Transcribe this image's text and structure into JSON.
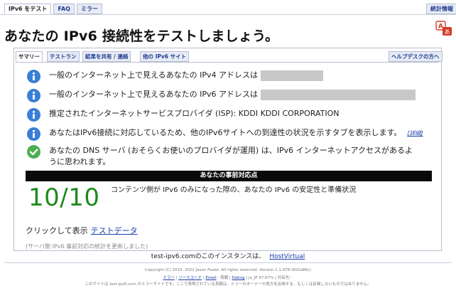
{
  "top_tabs": {
    "test": "IPv6 をテスト",
    "faq": "FAQ",
    "mirrors": "ミラー",
    "stats": "統計情報"
  },
  "headline": "あなたの IPv6 接続性をテストしましょう。",
  "sub_tabs": {
    "summary": "サマリー",
    "test_run": "テストラン",
    "share": "結果を共有 / 連絡",
    "other_sites": "他の IPv6 サイト",
    "helpdesk": "ヘルプデスクの方へ"
  },
  "rows": {
    "ipv4_label": "一般のインターネット上で見えるあなたの IPv4 アドレスは",
    "ipv6_label": "一般のインターネット上で見えるあなたの IPv6 アドレスは",
    "isp": "推定されたインターネットサービスプロバイダ (ISP): KDDI KDDI CORPORATION",
    "tabs_notice": "あなたはIPv6接続に対応しているため、他のIPv6サイトへの到達性の状況を示すタブを表示します。",
    "details_link": "[詳細]",
    "dns": "あなたの DNS サーバ (おそらくお使いのプロバイダが運用) は、IPv6 インターネットアクセスがあるように思われます。"
  },
  "readiness": {
    "header": "あなたの事前対応点",
    "score": "10/10",
    "description": "コンテンツ側が IPv6 のみになった際の、あなたの IPv6 の安定性と準備状況"
  },
  "click": {
    "prefix": "クリックして表示",
    "link": "テストデータ"
  },
  "note": "(サーバ側 IPv6 事前対応の統計を更新しました)",
  "instance": {
    "text": "test-ipv6.comのこのインスタンスは、",
    "host": "HostVirtual"
  },
  "footer": {
    "copyright": "Copyright (C) 2010, 2022 Jason Fesler. All rights reserved. Version 1.1.978 (802a86c)",
    "links": [
      "ミラー",
      "ソースコード",
      "Email",
      "傍聴",
      "Debug"
    ],
    "lang_pct": "ja_JP 97.67%",
    "translate": "共有先：",
    "mirror_note": "このサイトは test-ipv6.com のミラーサイトです。ここで表明されている見解は、ミラーのオーナーの見方を反映する、もしくは反映しないものではありません。"
  },
  "colors": {
    "score_green": "#1e8a1e",
    "info_blue": "#3a7fd5",
    "check_green": "#4caf50",
    "link_blue": "#1a3ea8"
  }
}
